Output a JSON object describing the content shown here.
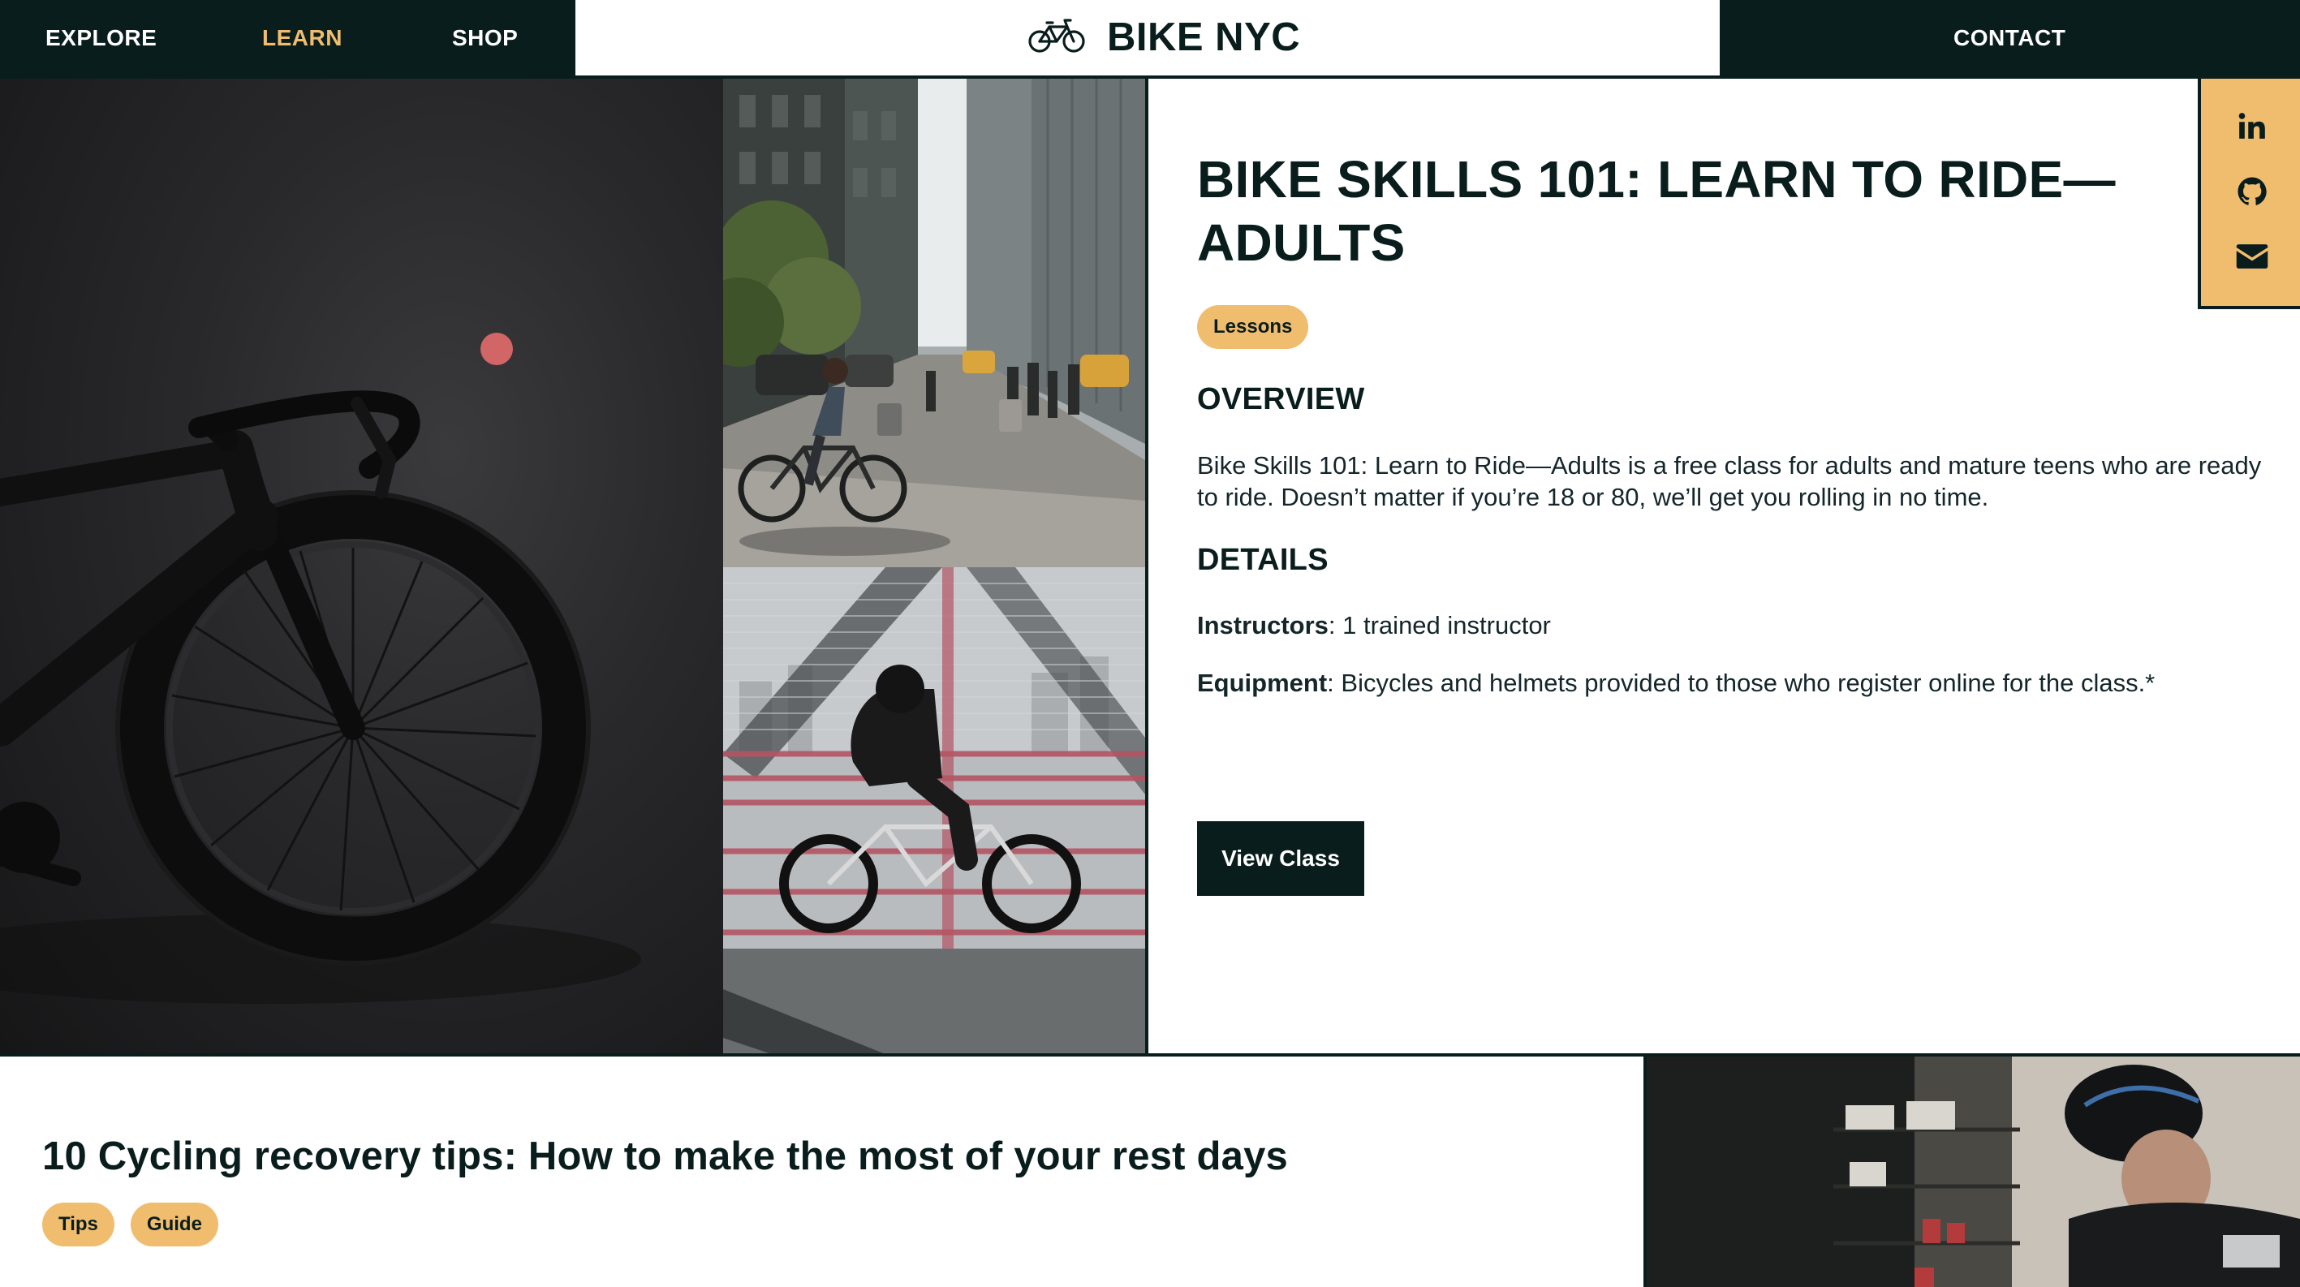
{
  "nav": {
    "links": [
      {
        "label": "EXPLORE",
        "active": false
      },
      {
        "label": "LEARN",
        "active": true
      },
      {
        "label": "SHOP",
        "active": false
      }
    ],
    "brand": "BIKE NYC",
    "brand_icon": "bicycle-icon",
    "contact": "CONTACT"
  },
  "hero": {
    "images": [
      "road-bike-photo",
      "city-street-cyclist-photo",
      "bridge-cyclist-photo"
    ]
  },
  "article": {
    "title": "BIKE SKILLS 101: LEARN TO RIDE—ADULTS",
    "tag": "Lessons",
    "overview_heading": "OVERVIEW",
    "overview_text": "Bike Skills 101: Learn to Ride—Adults is a free class for adults and mature teens who are ready to ride. Doesn’t matter if you’re 18 or 80, we’ll get you rolling in no time.",
    "details_heading": "DETAILS",
    "instructors_label": "Instructors",
    "instructors_value": ": 1 trained instructor",
    "equipment_label": "Equipment",
    "equipment_value": ": Bicycles and helmets provided to those who register online for the class.*",
    "button": "View Class"
  },
  "social": {
    "icons": [
      "linkedin-icon",
      "github-icon",
      "mail-icon"
    ]
  },
  "bottom": {
    "title": "10 Cycling recovery tips: How to make the most of your rest days",
    "tags": [
      "Tips",
      "Guide"
    ]
  },
  "colors": {
    "dark": "#0a1d1d",
    "accent": "#f0bd6e",
    "white": "#ffffff",
    "dot": "#d26565"
  }
}
